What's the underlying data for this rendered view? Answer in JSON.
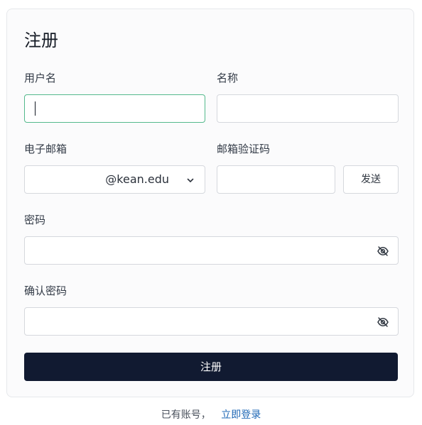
{
  "form": {
    "title": "注册",
    "username_label": "用户名",
    "name_label": "名称",
    "email_label": "电子邮箱",
    "email_suffix": "@kean.edu",
    "email_code_label": "邮箱验证码",
    "send_button_label": "发送",
    "password_label": "密码",
    "confirm_password_label": "确认密码",
    "submit_label": "注册",
    "icons": {
      "email_dropdown": "chevron-down-icon",
      "password_visibility": "eye-off-icon",
      "confirm_password_visibility": "eye-off-icon"
    },
    "colors": {
      "primary_button": "#111a31",
      "focus_border": "#54b98c",
      "link": "#1e67b5"
    }
  },
  "footer": {
    "prompt": "已有账号，",
    "login_link_label": "立即登录"
  }
}
